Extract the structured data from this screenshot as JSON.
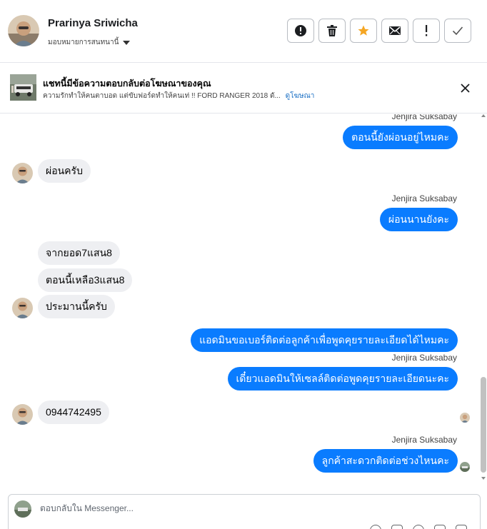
{
  "header": {
    "contact_name": "Prarinya Sriwicha",
    "assign_label": "มอบหมายการสนทนานี้",
    "actions": [
      {
        "name": "report-button",
        "icon": "alert-circle-icon"
      },
      {
        "name": "delete-button",
        "icon": "trash-icon"
      },
      {
        "name": "star-button",
        "icon": "star-icon"
      },
      {
        "name": "mark-unread-button",
        "icon": "envelope-icon"
      },
      {
        "name": "spam-button",
        "icon": "exclamation-icon"
      },
      {
        "name": "done-button",
        "icon": "check-icon"
      }
    ]
  },
  "ad_banner": {
    "title": "แชทนี้มีข้อความตอบกลับต่อโฆษณาของคุณ",
    "subtitle": "ความรักทำให้คนตาบอด แต่ขับฟอร์ดทำให้คนเท่ !! FORD RANGER 2018 ดั...",
    "link_label": "ดูโฆษณา"
  },
  "messages": [
    {
      "dir": "out",
      "sender": "Jenjira Suksabay",
      "text": "ตอนนี้ยังผ่อนอยู่ไหมคะ"
    },
    {
      "dir": "in",
      "text": "ผ่อนครับ"
    },
    {
      "dir": "out",
      "sender": "Jenjira Suksabay",
      "text": "ผ่อนนานยังคะ"
    },
    {
      "dir": "in",
      "text": "จากยอด7แสน8"
    },
    {
      "dir": "in",
      "text": "ตอนนี้เหลือ3แสน8"
    },
    {
      "dir": "in",
      "text": "ประมานนี้ครับ"
    },
    {
      "dir": "out",
      "text": "แอดมินขอเบอร์ติดต่อลูกค้าเพื่อพูดคุยรายละเอียดได้ไหมคะ"
    },
    {
      "dir": "out",
      "sender": "Jenjira Suksabay",
      "text": "เดี๋ยวแอดมินให้เซลล์ติดต่อพูดคุยรายละเอียดนะคะ"
    },
    {
      "dir": "in",
      "text": "0944742495"
    },
    {
      "dir": "out",
      "sender": "Jenjira Suksabay",
      "text": "ลูกค้าสะดวกติดต่อช่วงไหนคะ"
    }
  ],
  "composer": {
    "placeholder": "ตอบกลับใน Messenger..."
  },
  "colors": {
    "outgoing_bubble": "#0a7cff",
    "incoming_bubble": "#eeeff2",
    "star": "#f5a623"
  }
}
